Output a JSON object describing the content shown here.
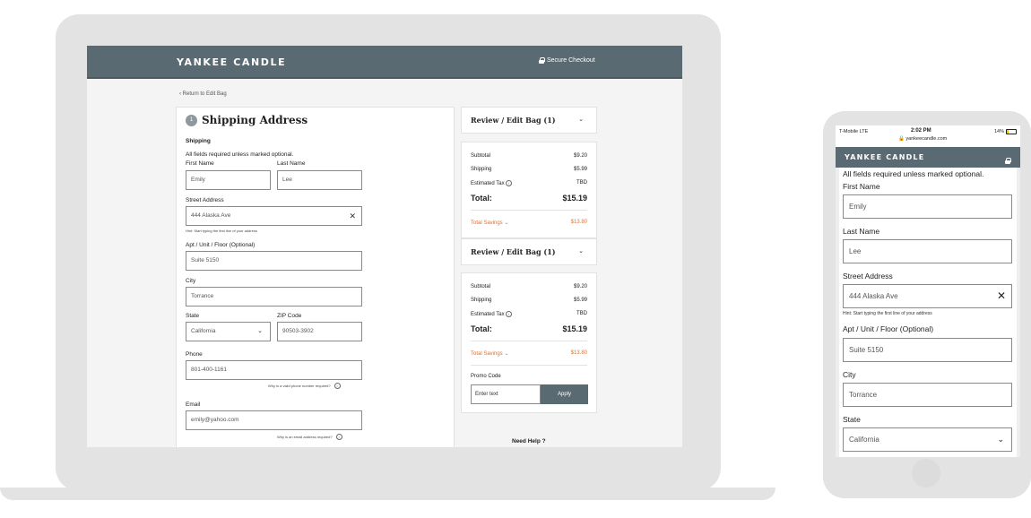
{
  "desktop": {
    "brand": "YANKEE CANDLE",
    "secure_checkout": "Secure Checkout",
    "return_link": "‹ Return to Edit Bag",
    "step_number": "1",
    "step_title": "Shipping Address",
    "section_label": "Shipping",
    "required_note": "All fields required unless marked optional.",
    "first_name": {
      "label": "First Name",
      "value": "Emily"
    },
    "last_name": {
      "label": "Last Name",
      "value": "Lee"
    },
    "street": {
      "label": "Street Address",
      "value": "444 Alaska Ave",
      "hint": "Hint: Start typing the first line of your address"
    },
    "apt": {
      "label": "Apt / Unit / Floor (Optional)",
      "value": "Suite 5150"
    },
    "city": {
      "label": "City",
      "value": "Torrance"
    },
    "state": {
      "label": "State",
      "value": "California"
    },
    "zip": {
      "label": "ZIP Code",
      "value": "90503-3902"
    },
    "phone": {
      "label": "Phone",
      "value": "801-400-1161",
      "why": "Why is a valid phone number required?"
    },
    "email": {
      "label": "Email",
      "value": "emily@yahoo.com",
      "why": "Why is an email address required?"
    },
    "review_title": "Review / Edit Bag (1)",
    "summary": {
      "subtotal_label": "Subtotal",
      "subtotal": "$9.20",
      "shipping_label": "Shipping",
      "shipping": "$5.99",
      "tax_label": "Estimated Tax",
      "tax": "TBD",
      "total_label": "Total:",
      "total": "$15.19",
      "savings_label": "Total Savings",
      "savings": "$13.80"
    },
    "promo": {
      "label": "Promo Code",
      "placeholder": "Enter text",
      "button": "Apply"
    },
    "need_help": "Need Help ?"
  },
  "mobile": {
    "carrier": "T-Mobile  LTE",
    "time": "2:02 PM",
    "battery": "14%",
    "url": "yankeecandle.com",
    "brand": "YANKEE CANDLE",
    "required_note": "All fields required unless marked optional.",
    "first_name": {
      "label": "First Name",
      "value": "Emily"
    },
    "last_name": {
      "label": "Last Name",
      "value": "Lee"
    },
    "street": {
      "label": "Street Address",
      "value": "444 Alaska Ave",
      "hint": "Hint: Start typing the first line of your address"
    },
    "apt": {
      "label": "Apt / Unit / Floor (Optional)",
      "value": "Suite 5150"
    },
    "city": {
      "label": "City",
      "value": "Torrance"
    },
    "state": {
      "label": "State",
      "value": "California"
    }
  },
  "colors": {
    "header": "#5a6a72",
    "savings": "#e0712f",
    "device": "#e3e3e3"
  }
}
